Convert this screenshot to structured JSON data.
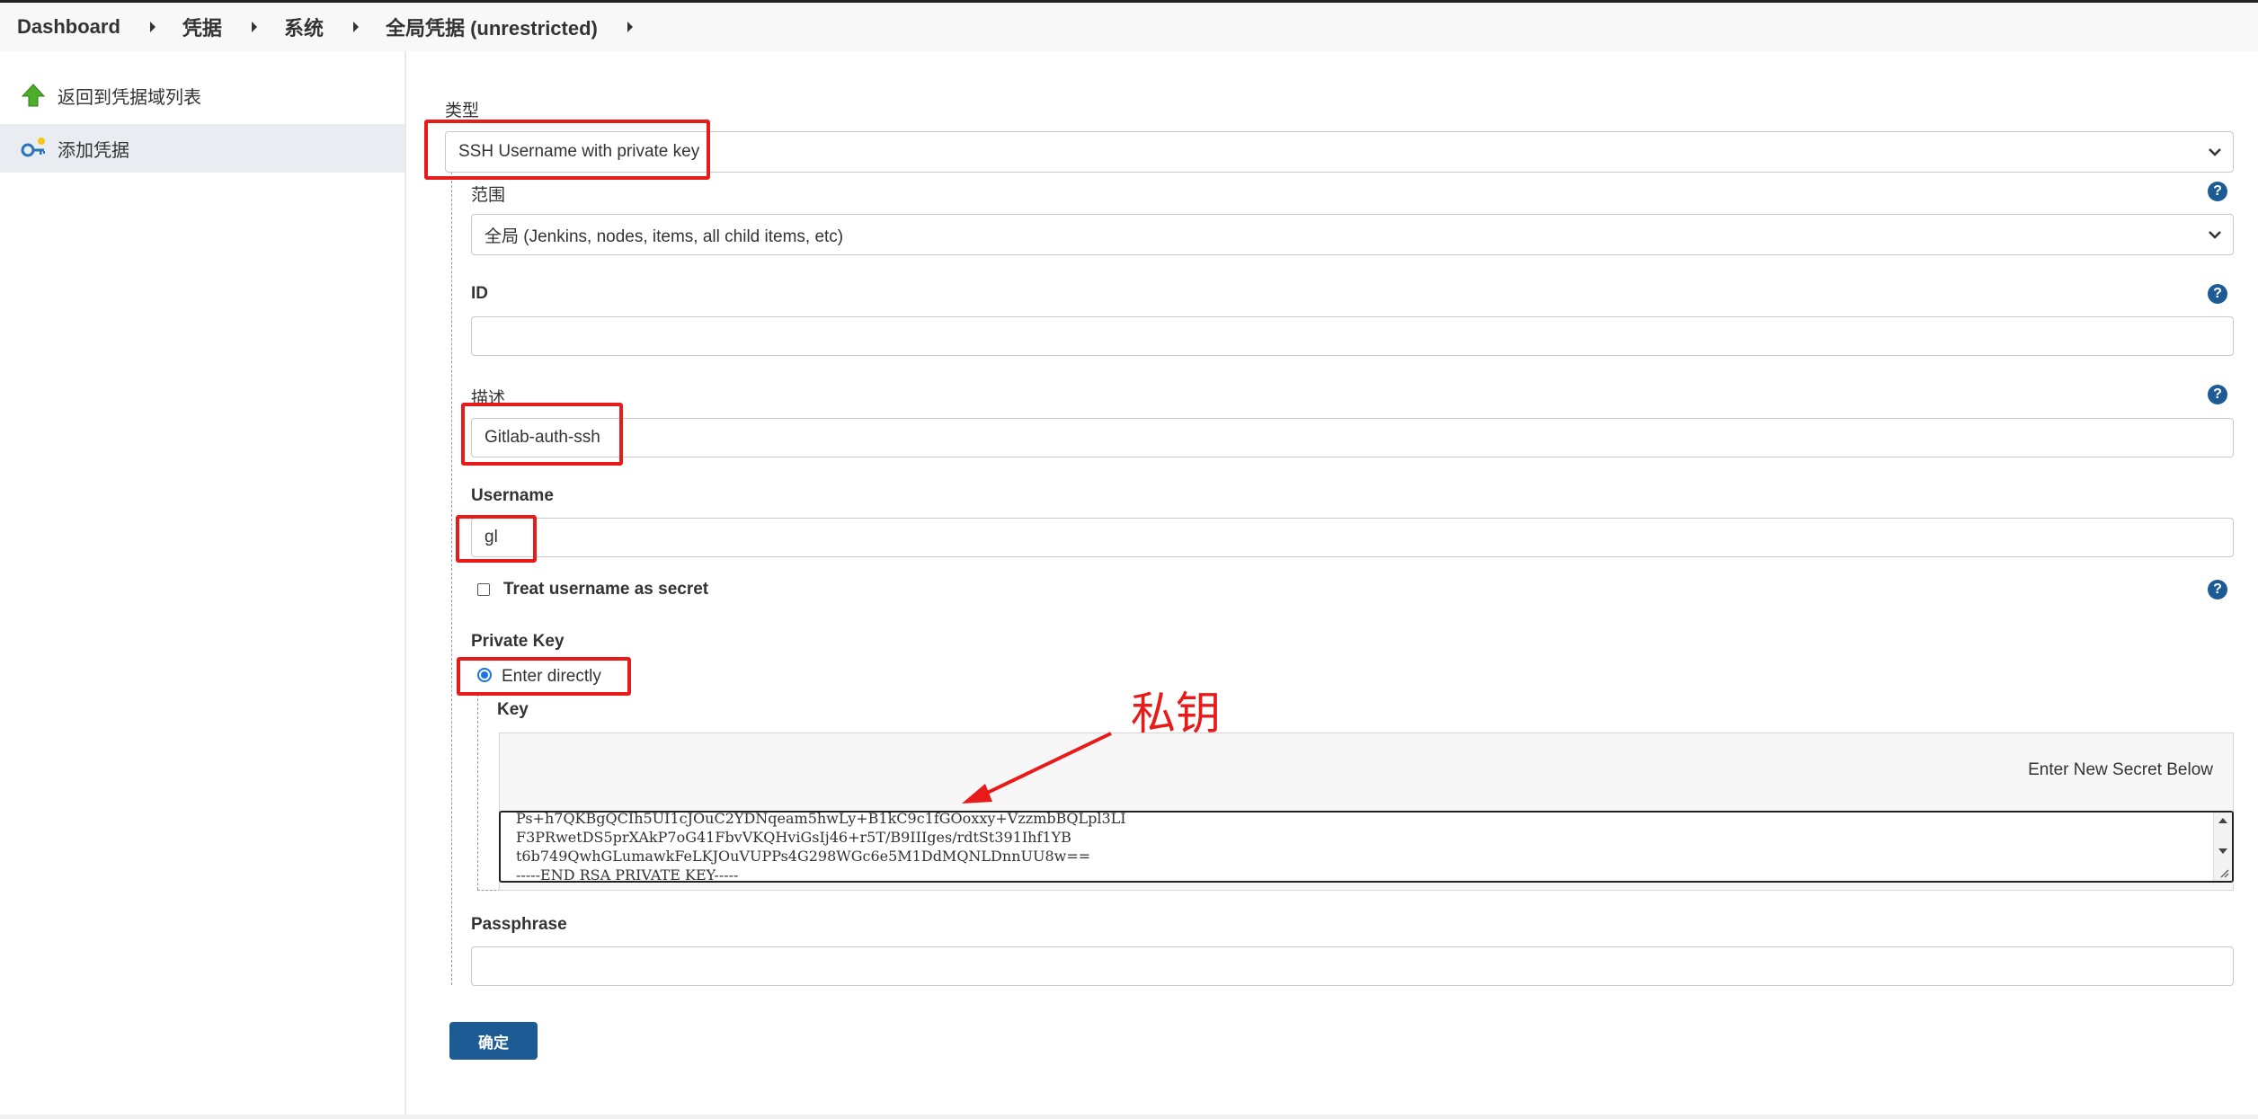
{
  "breadcrumb": {
    "items": [
      "Dashboard",
      "凭据",
      "系统",
      "全局凭据 (unrestricted)"
    ]
  },
  "sidebar": {
    "items": [
      {
        "label": "返回到凭据域列表",
        "icon": "up-arrow-icon"
      },
      {
        "label": "添加凭据",
        "icon": "key-icon"
      }
    ]
  },
  "form": {
    "kind_label": "类型",
    "kind_value": "SSH Username with private key",
    "scope_label": "范围",
    "scope_value": "全局 (Jenkins, nodes, items, all child items, etc)",
    "id_label": "ID",
    "id_value": "",
    "description_label": "描述",
    "description_value": "Gitlab-auth-ssh",
    "username_label": "Username",
    "username_value": "gl",
    "treat_secret_label": "Treat username as secret",
    "private_key_label": "Private Key",
    "enter_directly_label": "Enter directly",
    "key_label": "Key",
    "enter_secret_label": "Enter New Secret Below",
    "key_lines": [
      "Ps+h7QKBgQCIh5UI1cJOuC2YDNqeam5hwLy+B1kC9c1fGOoxxy+VzzmbBQLpl3LI",
      "F3PRwetDS5prXAkP7oG41FbvVKQHviGsIj46+r5T/B9IIIges/rdtSt391Ihf1YB",
      "t6b749QwhGLumawkFeLKJOuVUPPs4G298WGc6e5M1DdMQNLDnnUU8w==",
      "-----END RSA PRIVATE KEY-----"
    ],
    "passphrase_label": "Passphrase",
    "passphrase_value": "",
    "submit_label": "确定"
  },
  "annotation": {
    "text": "私钥",
    "color": "#e81b1b"
  },
  "colors": {
    "accent": "#1d5b95",
    "highlight": "#e81b1b"
  }
}
